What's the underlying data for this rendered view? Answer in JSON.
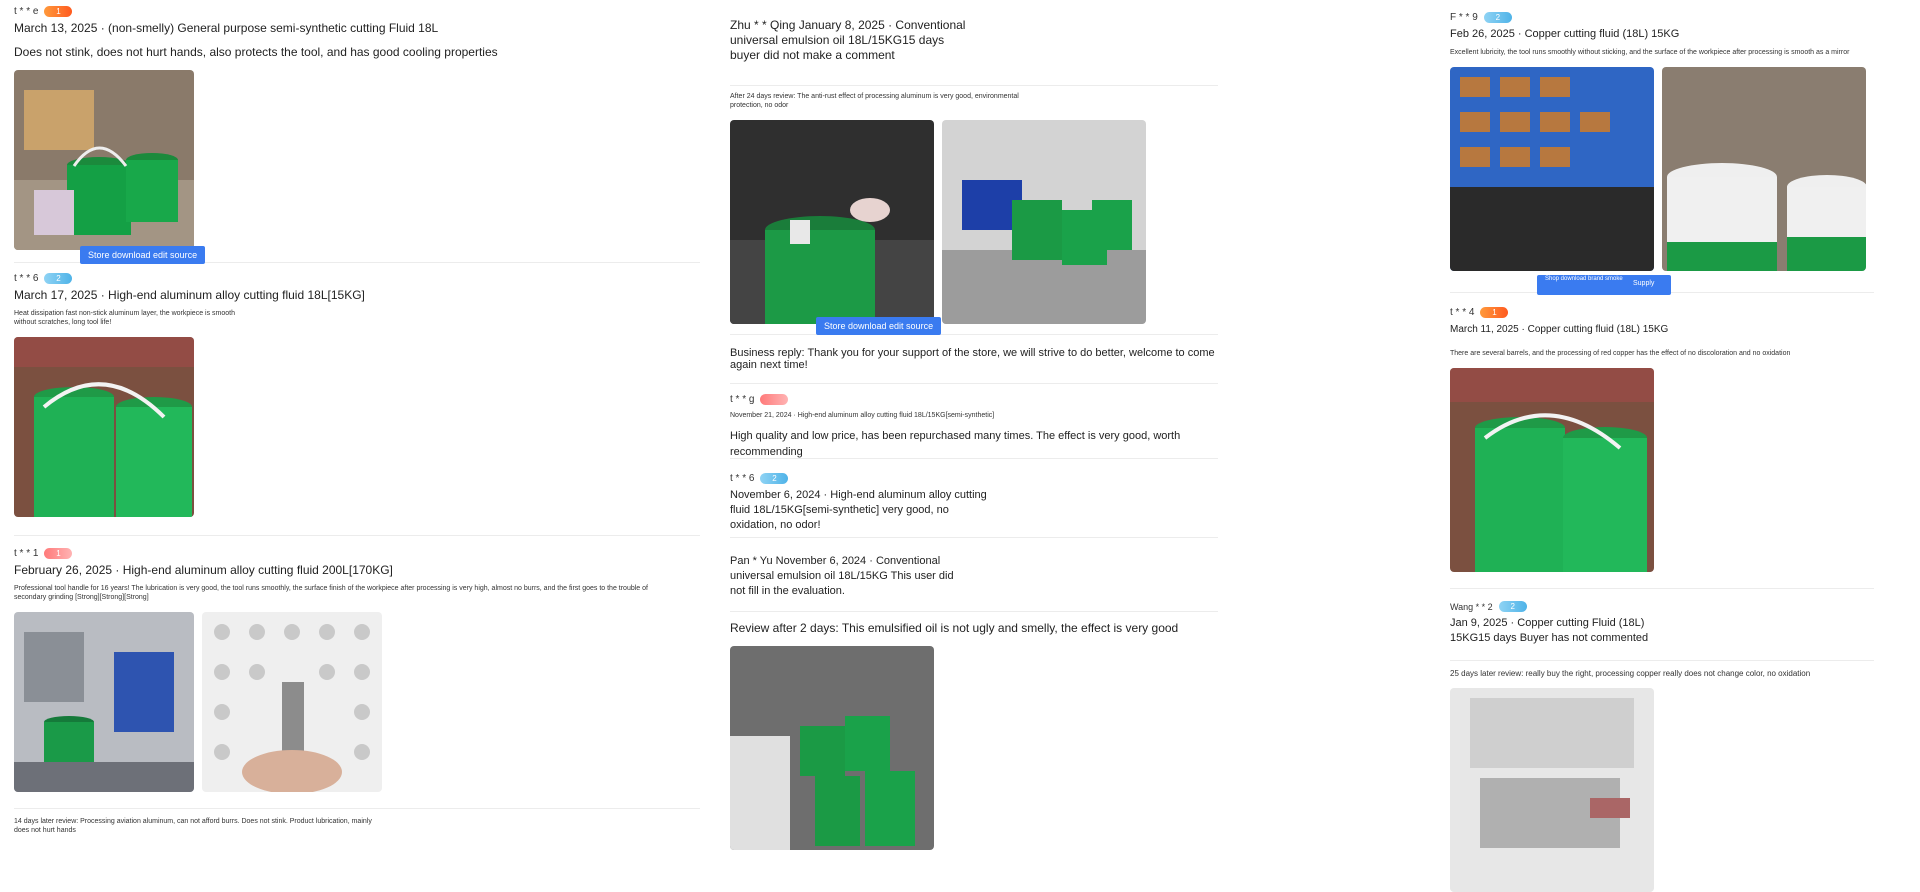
{
  "col1": {
    "r1": {
      "user": "t * * e",
      "badge": "1",
      "meta": "March 13, 2025 · (non-smelly) General purpose semi-synthetic cutting Fluid 18L",
      "body": "Does not stink, does not hurt hands, also protects the tool, and has good cooling properties",
      "button": "Store download edit source"
    },
    "r2": {
      "user": "t * * 6",
      "badge": "2",
      "meta": "March 17, 2025 · High-end aluminum alloy cutting fluid 18L[15KG]",
      "small": "Heat dissipation fast non-stick aluminum layer, the workpiece is smooth without scratches, long tool life!"
    },
    "r3": {
      "user": "t * * 1",
      "badge": "1",
      "meta": "February 26, 2025 · High-end aluminum alloy cutting fluid 200L[170KG]",
      "small": "Professional tool handle for 16 years! The lubrication is very good, the tool runs smoothly, the surface finish of the workpiece after processing is very high, almost no burrs, and the first goes to the trouble of secondary grinding [Strong][Strong][Strong]"
    },
    "r4": {
      "small": "14 days later review: Processing aviation aluminum, can not afford burrs. Does not stink. Product lubrication, mainly does not hurt hands"
    }
  },
  "col2": {
    "r1": {
      "meta": "Zhu * * Qing January 8, 2025 · Conventional universal emulsion oil 18L/15KG15 days buyer did not make a comment",
      "small": "After 24 days review: The anti-rust effect of processing aluminum is very good, environmental protection, no odor",
      "button": "Store download edit source"
    },
    "r2": {
      "reply": "Business reply: Thank you for your support of the store, we will strive to do better, welcome to come again next time!"
    },
    "r3": {
      "user": "t * * g",
      "small": "November 21, 2024 · High-end aluminum alloy cutting fluid 18L/15KG[semi-synthetic]",
      "body": "High quality and low price, has been repurchased many times. The effect is very good, worth recommending"
    },
    "r4": {
      "user": "t * * 6",
      "badge": "2",
      "meta": "November 6, 2024 · High-end aluminum alloy cutting fluid 18L/15KG[semi-synthetic] very good, no oxidation, no odor!"
    },
    "r5": {
      "meta": "Pan * Yu November 6, 2024 · Conventional universal emulsion oil 18L/15KG This user did not fill in the evaluation.",
      "body": "Review after 2 days: This emulsified oil is not ugly and smelly, the effect is very good"
    }
  },
  "col3": {
    "r1": {
      "user": "F * * 9",
      "badge": "2",
      "meta": "Feb 26, 2025 · Copper cutting fluid (18L) 15KG",
      "small": "Excellent lubricity, the tool runs smoothly without sticking, and the surface of the workpiece after processing is smooth as a mirror",
      "button": "Shop download brand smoke",
      "button2": "Supply"
    },
    "r2": {
      "user": "t * * 4",
      "badge": "1",
      "meta": "March 11, 2025 · Copper cutting fluid (18L) 15KG",
      "small": "There are several barrels, and the processing of red copper has the effect of no discoloration and no oxidation"
    },
    "r3": {
      "user": "Wang * * 2",
      "badge": "2",
      "meta": "Jan 9, 2025 · Copper cutting Fluid (18L) 15KG15 days Buyer has not commented",
      "small": "25 days later review: really buy the right, processing copper really does not change color, no oxidation"
    }
  }
}
